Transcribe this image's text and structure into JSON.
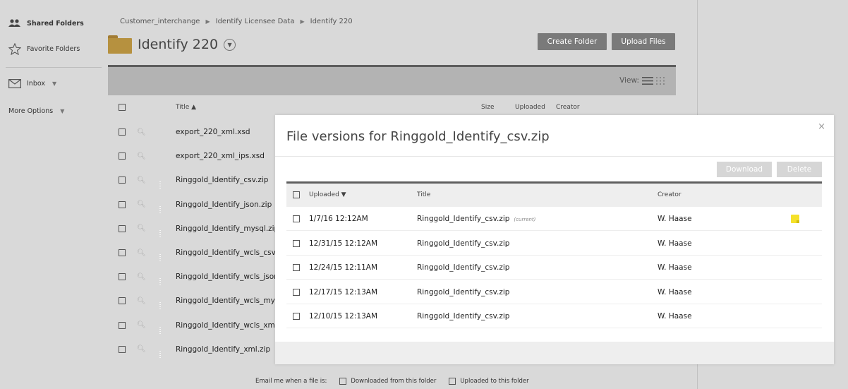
{
  "sidebar": {
    "shared_folders": "Shared Folders",
    "favorite_folders": "Favorite Folders",
    "inbox": "Inbox",
    "more_options": "More Options"
  },
  "breadcrumb": [
    "Customer_interchange",
    "Identify Licensee Data",
    "Identify 220"
  ],
  "folder": {
    "title": "Identify 220"
  },
  "toolbar": {
    "create_folder": "Create Folder",
    "upload_files": "Upload Files",
    "view_label": "View:"
  },
  "list": {
    "headers": {
      "title": "Title ▲",
      "size": "Size",
      "uploaded": "Uploaded",
      "creator": "Creator"
    },
    "files": [
      {
        "name": "export_220_xml.xsd",
        "type": "doc"
      },
      {
        "name": "export_220_xml_ips.xsd",
        "type": "doc"
      },
      {
        "name": "Ringgold_Identify_csv.zip",
        "type": "zip"
      },
      {
        "name": "Ringgold_Identify_json.zip",
        "type": "zip"
      },
      {
        "name": "Ringgold_Identify_mysql.zip",
        "type": "zip"
      },
      {
        "name": "Ringgold_Identify_wcls_csv.",
        "type": "zip"
      },
      {
        "name": "Ringgold_Identify_wcls_jsor",
        "type": "zip"
      },
      {
        "name": "Ringgold_Identify_wcls_mys",
        "type": "zip"
      },
      {
        "name": "Ringgold_Identify_wcls_xml",
        "type": "zip"
      },
      {
        "name": "Ringgold_Identify_xml.zip",
        "type": "zip"
      }
    ]
  },
  "email_bar": {
    "label": "Email me when a file is:",
    "downloaded": "Downloaded from this folder",
    "uploaded": "Uploaded to this folder"
  },
  "modal": {
    "title": "File versions for Ringgold_Identify_csv.zip",
    "close": "×",
    "download": "Download",
    "delete": "Delete",
    "headers": {
      "uploaded": "Uploaded ▼",
      "title": "Title",
      "creator": "Creator"
    },
    "current_tag": "(current)",
    "versions": [
      {
        "uploaded": "1/7/16 12:12AM",
        "title": "Ringgold_Identify_csv.zip",
        "creator": "W. Haase",
        "current": true
      },
      {
        "uploaded": "12/31/15 12:12AM",
        "title": "Ringgold_Identify_csv.zip",
        "creator": "W. Haase",
        "current": false
      },
      {
        "uploaded": "12/24/15 12:11AM",
        "title": "Ringgold_Identify_csv.zip",
        "creator": "W. Haase",
        "current": false
      },
      {
        "uploaded": "12/17/15 12:13AM",
        "title": "Ringgold_Identify_csv.zip",
        "creator": "W. Haase",
        "current": false
      },
      {
        "uploaded": "12/10/15 12:13AM",
        "title": "Ringgold_Identify_csv.zip",
        "creator": "W. Haase",
        "current": false
      }
    ]
  },
  "colors": {
    "button_dark": "#7a7a7a",
    "folder": "#b6913f",
    "zip": "#c79a2e",
    "doc": "#3a7bb9",
    "note": "#f5e12a"
  }
}
